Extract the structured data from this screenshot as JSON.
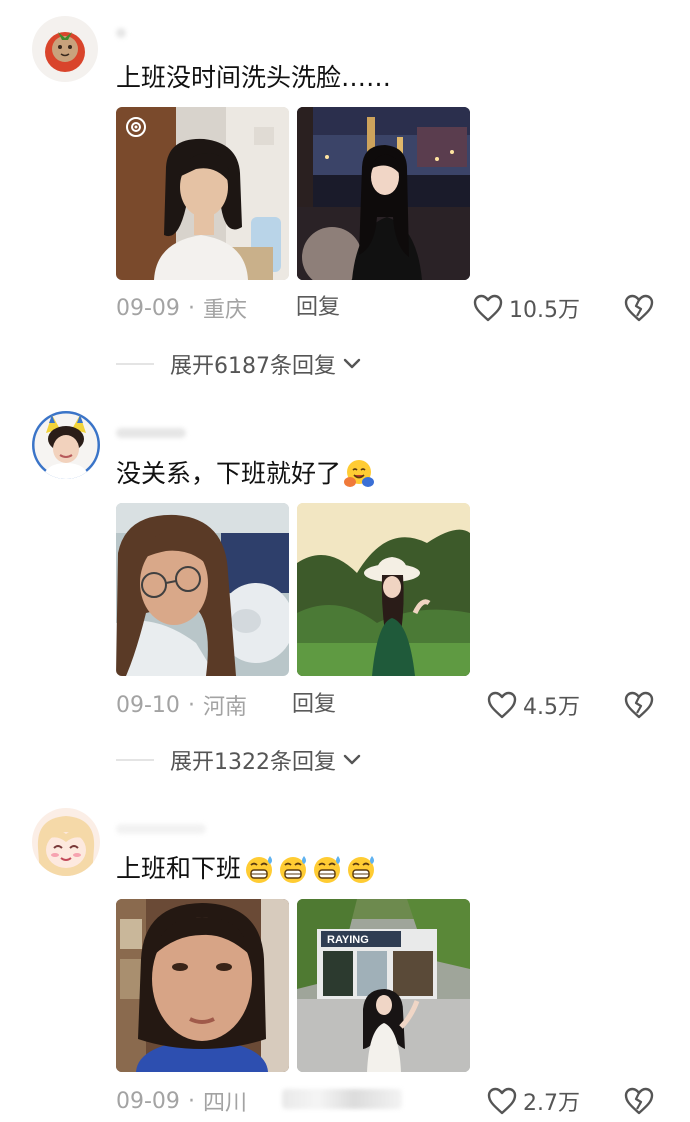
{
  "comments": [
    {
      "text": "上班没时间洗头洗脸……",
      "emojis": [],
      "date": "09-09",
      "location": "重庆",
      "reply_label": "回复",
      "likes": "10.5万",
      "expand_label": "展开6187条回复"
    },
    {
      "text": "没关系，下班就好了",
      "emojis": [
        "hugging-face-emoji"
      ],
      "date": "09-10",
      "location": "河南",
      "reply_label": "回复",
      "likes": "4.5万",
      "expand_label": "展开1322条回复"
    },
    {
      "text": "上班和下班",
      "emojis": [
        "grinning-sweat-emoji",
        "grinning-sweat-emoji",
        "grinning-sweat-emoji",
        "grinning-sweat-emoji"
      ],
      "date": "09-09",
      "location": "四川",
      "reply_label": "",
      "likes": "2.7万"
    }
  ],
  "separator": "·",
  "icons": {
    "like": "heart-outline-icon",
    "dislike": "broken-heart-icon",
    "expand": "chevron-down-icon",
    "photo_badge": "live-photo-icon"
  },
  "colors": {
    "text": "#111111",
    "meta": "#a3a3a3",
    "action": "#555555"
  }
}
